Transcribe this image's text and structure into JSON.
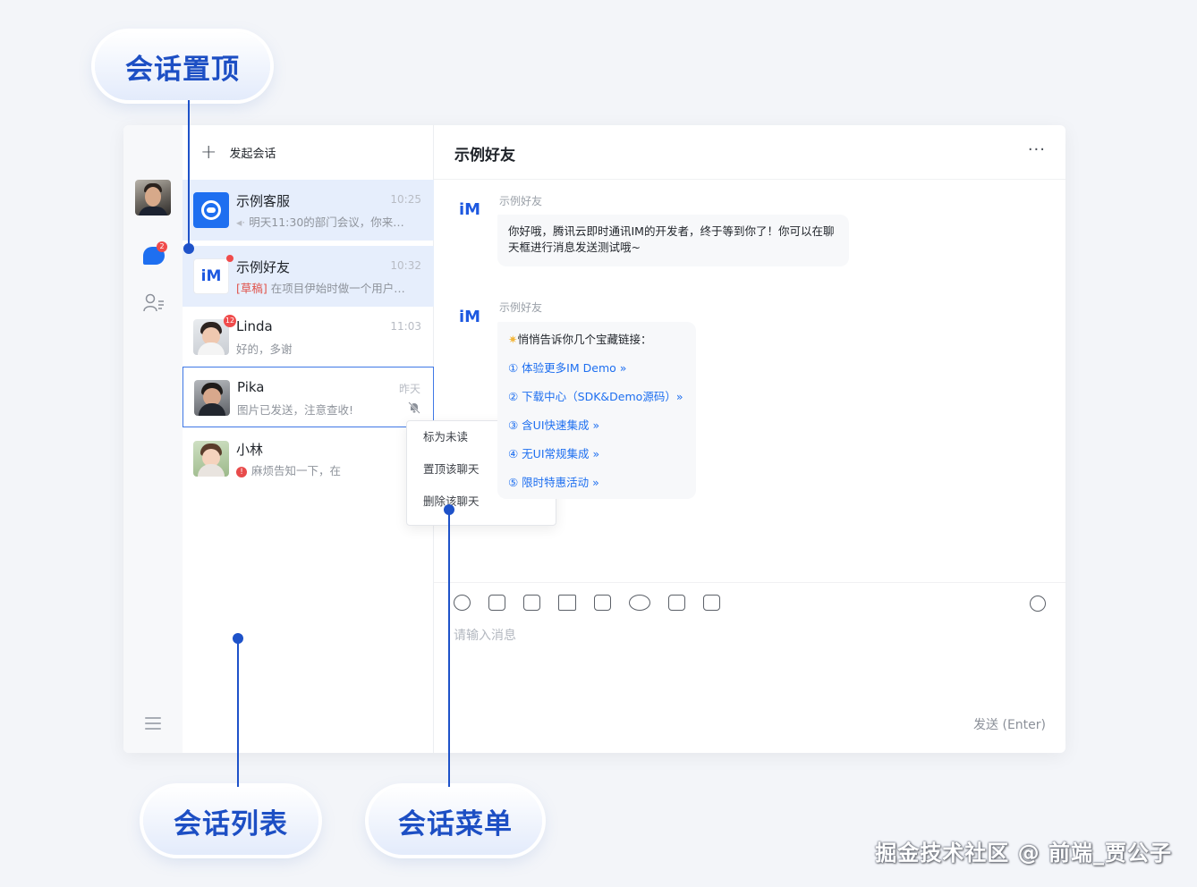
{
  "callouts": {
    "pin": "会话置顶",
    "list": "会话列表",
    "menu": "会话菜单"
  },
  "nav": {
    "unread_badge": "2"
  },
  "list": {
    "new_chat_label": "发起会话",
    "conversations": [
      {
        "name": "示例客服",
        "time": "10:25",
        "message": "明天11:30的部门会议，你来…",
        "prefix": "◂·"
      },
      {
        "name": "示例好友",
        "time": "10:32",
        "draft_tag": "[草稿]",
        "message": "在项目伊始时做一个用户…",
        "avatar_text": "iM"
      },
      {
        "name": "Linda",
        "time": "11:03",
        "message": "好的，多谢",
        "badge": "12"
      },
      {
        "name": "Pika",
        "time": "昨天",
        "message": "图片已发送，注意查收!"
      },
      {
        "name": "小林",
        "time": "",
        "message": "麻烦告知一下，在",
        "warn": "!"
      }
    ]
  },
  "context_menu": {
    "items": [
      "标为未读",
      "置顶该聊天",
      "删除该聊天"
    ]
  },
  "chat": {
    "title": "示例好友",
    "more": "···",
    "messages": [
      {
        "sender": "示例好友",
        "avatar_text": "iM",
        "text": "你好哦，腾讯云即时通讯IM的开发者，终于等到你了！你可以在聊天框进行消息发送测试哦~"
      },
      {
        "sender": "示例好友",
        "avatar_text": "iM",
        "intro": "悄悄告诉你几个宝藏链接：",
        "links": [
          "① 体验更多IM Demo »",
          "② 下载中心（SDK&Demo源码）»",
          "③ 含UI快速集成 »",
          "④ 无UI常规集成 »",
          "⑤ 限时特惠活动 »"
        ]
      }
    ],
    "input_placeholder": "请输入消息",
    "send_label": "发送 (Enter)"
  },
  "watermark": "掘金技术社区 @ 前端_贾公子",
  "colors": {
    "accent": "#1e52c9",
    "link": "#1e6ff0",
    "active_row": "#e6eefc",
    "badge": "#f04b4b"
  }
}
